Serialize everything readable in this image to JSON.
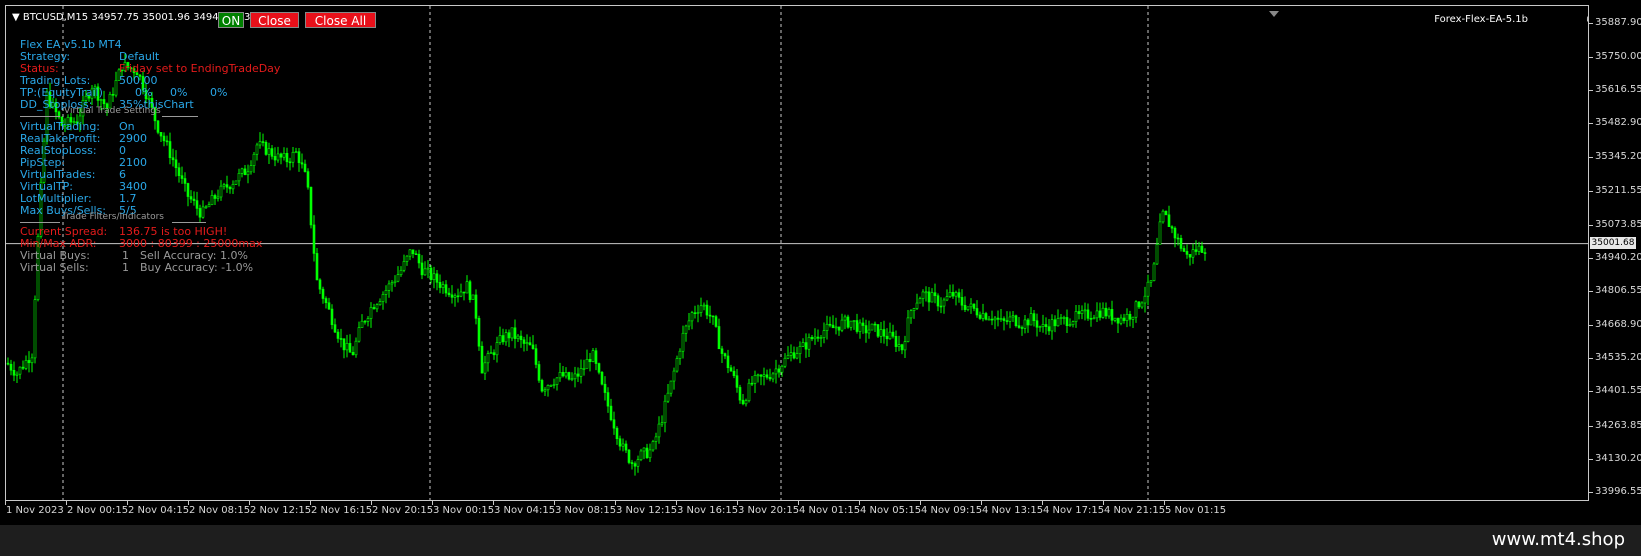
{
  "symbol_info": "BTCUSD,M15  34957.75 35001.96 34949.65 35001.68",
  "buttons": {
    "on": "ON",
    "close": "Close",
    "close_all": "Close All"
  },
  "ea_name": "Forex-Flex-EA-5.1b",
  "smiley": "☺",
  "panel": {
    "title": "Flex EA v5.1b MT4",
    "rows": [
      {
        "label": "Strategy:",
        "value": "Default"
      },
      {
        "label": "Status:",
        "value": "Friday set to EndingTradeDay"
      },
      {
        "label": "Trading Lots:",
        "value": "500.00"
      },
      {
        "label": "TP:(EquityTrail)",
        "value": "0%",
        "value2": "0%",
        "value3": "0%"
      },
      {
        "label": "DD_Stoploss:",
        "value": "35%thisChart"
      }
    ],
    "section_virtual": "Virtual Trade Settings",
    "virtual_rows": [
      {
        "label": "VirtualTrading:",
        "value": "On"
      },
      {
        "label": "RealTakeProfit:",
        "value": "2900"
      },
      {
        "label": "RealStopLoss:",
        "value": "0"
      },
      {
        "label": "PipStep:",
        "value": "2100"
      },
      {
        "label": "VirtualTrades:",
        "value": "6"
      },
      {
        "label": "VirtualTP:",
        "value": "3400"
      },
      {
        "label": "LotMultiplier:",
        "value": "1.7"
      },
      {
        "label": "Max Buys/Sells:",
        "value": "5/5"
      }
    ],
    "section_filters": "Trade Filters/Indicators",
    "filter_rows": [
      {
        "label": "Current Spread:",
        "value": "136.75 is too HIGH!"
      },
      {
        "label": "Min/Max ADR:",
        "value": "3000 : 80399 : 25000max"
      }
    ],
    "stats_rows": [
      {
        "label": "Virtual Buys:",
        "count": "1",
        "stat": "Sell Accuracy: 1.0%"
      },
      {
        "label": "Virtual Sells:",
        "count": "1",
        "stat": "Buy Accuracy: -1.0%"
      }
    ]
  },
  "chart_data": {
    "type": "candlestick",
    "symbol": "BTCUSD",
    "timeframe": "M15",
    "bid_price": 35001.68,
    "price_ticks": [
      "35887.90",
      "35750.00",
      "35616.55",
      "35482.90",
      "35345.20",
      "35211.55",
      "35073.85",
      "34940.20",
      "34806.55",
      "34668.90",
      "34535.20",
      "34401.55",
      "34263.85",
      "34130.20",
      "33996.55"
    ],
    "price_tick_values": [
      35887.9,
      35750.0,
      35616.55,
      35482.9,
      35345.2,
      35211.55,
      35073.85,
      34940.2,
      34806.55,
      34668.9,
      34535.2,
      34401.55,
      34263.85,
      34130.2,
      33996.55
    ],
    "time_ticks": [
      "1 Nov 2023",
      "2 Nov 00:15",
      "2 Nov 04:15",
      "2 Nov 08:15",
      "2 Nov 12:15",
      "2 Nov 16:15",
      "2 Nov 20:15",
      "3 Nov 00:15",
      "3 Nov 04:15",
      "3 Nov 08:15",
      "3 Nov 12:15",
      "3 Nov 16:15",
      "3 Nov 20:15",
      "4 Nov 01:15",
      "4 Nov 05:15",
      "4 Nov 09:15",
      "4 Nov 13:15",
      "4 Nov 17:15",
      "4 Nov 21:15",
      "5 Nov 01:15"
    ],
    "ylim": [
      33960,
      35960
    ],
    "bid_line_color": "#c8c8c8",
    "candle_color": "#00ff00",
    "close_path": [
      [
        0,
        34520
      ],
      [
        10,
        34480
      ],
      [
        25,
        34560
      ],
      [
        32,
        35100
      ],
      [
        40,
        35600
      ],
      [
        55,
        35480
      ],
      [
        70,
        35500
      ],
      [
        85,
        35640
      ],
      [
        100,
        35550
      ],
      [
        115,
        35720
      ],
      [
        130,
        35700
      ],
      [
        140,
        35600
      ],
      [
        150,
        35480
      ],
      [
        165,
        35350
      ],
      [
        180,
        35200
      ],
      [
        195,
        35120
      ],
      [
        210,
        35200
      ],
      [
        225,
        35250
      ],
      [
        240,
        35300
      ],
      [
        250,
        35400
      ],
      [
        260,
        35380
      ],
      [
        270,
        35350
      ],
      [
        280,
        35340
      ],
      [
        290,
        35370
      ],
      [
        300,
        35250
      ],
      [
        310,
        34850
      ],
      [
        325,
        34700
      ],
      [
        335,
        34600
      ],
      [
        345,
        34550
      ],
      [
        355,
        34680
      ],
      [
        365,
        34750
      ],
      [
        380,
        34820
      ],
      [
        395,
        34900
      ],
      [
        405,
        34980
      ],
      [
        415,
        34900
      ],
      [
        430,
        34850
      ],
      [
        440,
        34820
      ],
      [
        450,
        34800
      ],
      [
        460,
        34830
      ],
      [
        468,
        34750
      ],
      [
        475,
        34500
      ],
      [
        485,
        34560
      ],
      [
        495,
        34620
      ],
      [
        505,
        34640
      ],
      [
        515,
        34600
      ],
      [
        525,
        34580
      ],
      [
        535,
        34420
      ],
      [
        545,
        34450
      ],
      [
        555,
        34470
      ],
      [
        565,
        34450
      ],
      [
        575,
        34490
      ],
      [
        585,
        34560
      ],
      [
        595,
        34420
      ],
      [
        605,
        34300
      ],
      [
        615,
        34180
      ],
      [
        625,
        34120
      ],
      [
        635,
        34150
      ],
      [
        645,
        34170
      ],
      [
        655,
        34300
      ],
      [
        665,
        34450
      ],
      [
        675,
        34620
      ],
      [
        685,
        34720
      ],
      [
        695,
        34760
      ],
      [
        705,
        34700
      ],
      [
        715,
        34560
      ],
      [
        725,
        34480
      ],
      [
        735,
        34360
      ],
      [
        745,
        34440
      ],
      [
        755,
        34460
      ],
      [
        765,
        34480
      ],
      [
        775,
        34520
      ],
      [
        785,
        34560
      ],
      [
        795,
        34580
      ],
      [
        805,
        34620
      ],
      [
        815,
        34650
      ],
      [
        825,
        34660
      ],
      [
        835,
        34680
      ],
      [
        845,
        34690
      ],
      [
        855,
        34650
      ],
      [
        865,
        34660
      ],
      [
        875,
        34640
      ],
      [
        885,
        34620
      ],
      [
        895,
        34580
      ],
      [
        905,
        34750
      ],
      [
        915,
        34800
      ],
      [
        925,
        34780
      ],
      [
        935,
        34760
      ],
      [
        945,
        34800
      ],
      [
        955,
        34760
      ],
      [
        965,
        34740
      ],
      [
        975,
        34720
      ],
      [
        985,
        34710
      ],
      [
        995,
        34680
      ],
      [
        1005,
        34700
      ],
      [
        1015,
        34680
      ],
      [
        1025,
        34700
      ],
      [
        1035,
        34660
      ],
      [
        1045,
        34680
      ],
      [
        1055,
        34690
      ],
      [
        1065,
        34700
      ],
      [
        1075,
        34710
      ],
      [
        1085,
        34720
      ],
      [
        1095,
        34730
      ],
      [
        1105,
        34710
      ],
      [
        1115,
        34700
      ],
      [
        1125,
        34720
      ],
      [
        1135,
        34780
      ],
      [
        1145,
        34850
      ],
      [
        1155,
        35120
      ],
      [
        1160,
        35100
      ],
      [
        1170,
        35020
      ],
      [
        1180,
        34950
      ],
      [
        1190,
        34980
      ],
      [
        1200,
        34990
      ]
    ]
  },
  "footer": "www.mt4.shop"
}
